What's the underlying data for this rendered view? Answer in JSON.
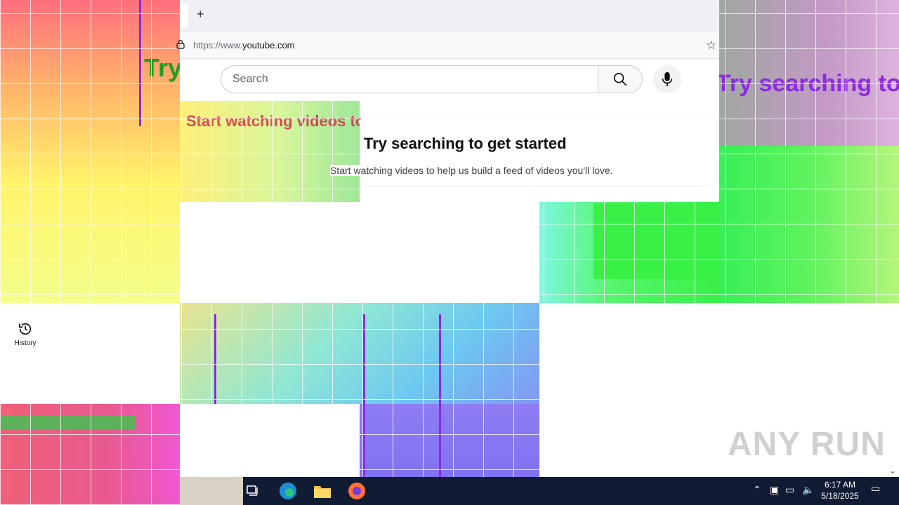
{
  "browser": {
    "new_tab_symbol": "+",
    "url_scheme": "https://www.",
    "url_host": "youtube.com",
    "bookmark_icon": "star-outline-icon"
  },
  "youtube": {
    "search_placeholder": "Search",
    "search_icon": "magnifier-icon",
    "mic_icon": "microphone-icon",
    "empty_title": "Try searching to get started",
    "empty_subtitle": "Start watching videos to help us build a feed of videos you'll love."
  },
  "sidebar": {
    "history_label": "History",
    "history_icon": "history-icon"
  },
  "taskbar": {
    "time": "6:17 AM",
    "date": "5/18/2025",
    "pinned": [
      "task-view-icon",
      "edge-icon",
      "file-explorer-icon",
      "firefox-icon"
    ]
  },
  "watermark": "ANY RUN",
  "colors": {
    "taskbar_bg": "#101c33",
    "headline_ghost_green": "#1f9e1f",
    "headline_ghost_purple": "#8a2be2",
    "sub_ghost_red": "#d0304a"
  }
}
